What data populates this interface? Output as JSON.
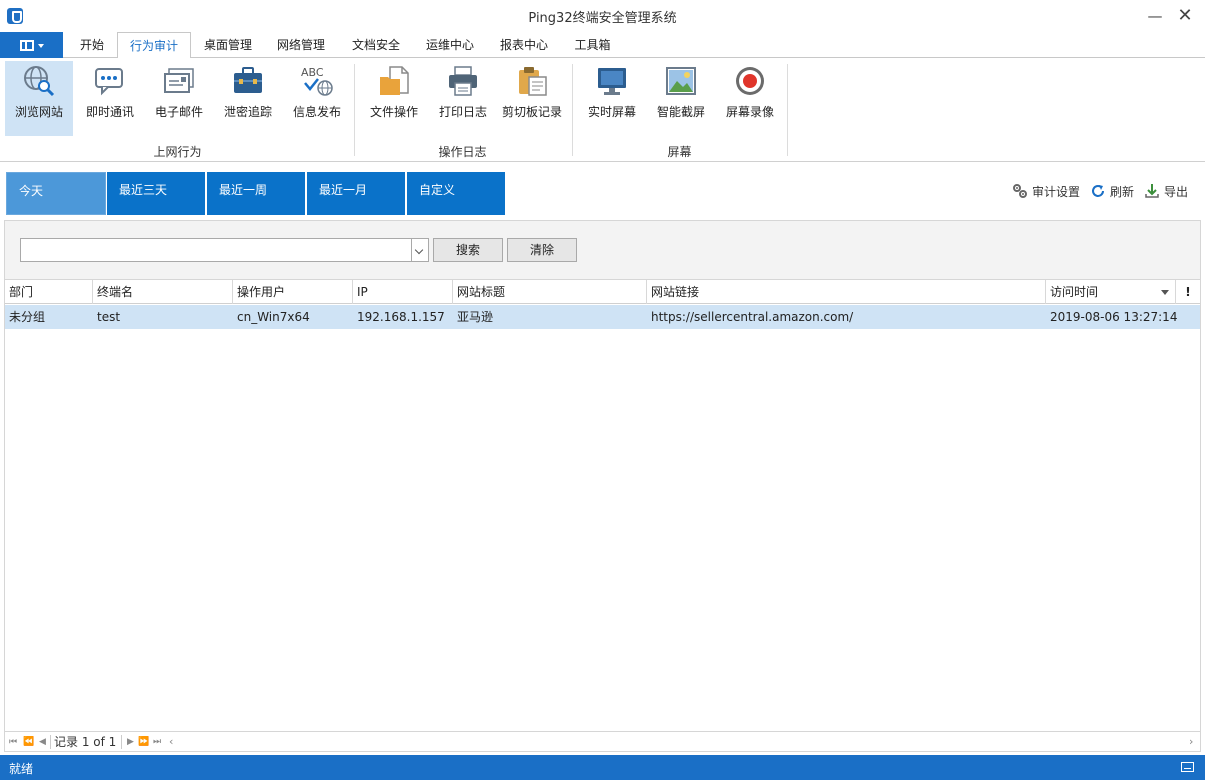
{
  "window": {
    "title": "Ping32终端安全管理系统"
  },
  "menu": {
    "tabs": [
      "开始",
      "行为审计",
      "桌面管理",
      "网络管理",
      "文档安全",
      "运维中心",
      "报表中心",
      "工具箱"
    ],
    "active_index": 1
  },
  "ribbon": {
    "groups": [
      {
        "label": "上网行为",
        "items": [
          {
            "label": "浏览网站",
            "icon": "globe-search-icon",
            "active": true
          },
          {
            "label": "即时通讯",
            "icon": "chat-bubble-icon"
          },
          {
            "label": "电子邮件",
            "icon": "email-icon"
          },
          {
            "label": "泄密追踪",
            "icon": "briefcase-icon"
          },
          {
            "label": "信息发布",
            "icon": "abc-globe-icon",
            "icon_text": "ABC"
          }
        ]
      },
      {
        "label": "操作日志",
        "items": [
          {
            "label": "文件操作",
            "icon": "file-folder-icon"
          },
          {
            "label": "打印日志",
            "icon": "printer-icon"
          },
          {
            "label": "剪切板记录",
            "icon": "clipboard-icon"
          }
        ]
      },
      {
        "label": "屏幕",
        "items": [
          {
            "label": "实时屏幕",
            "icon": "monitor-icon"
          },
          {
            "label": "智能截屏",
            "icon": "screenshot-picture-icon"
          },
          {
            "label": "屏幕录像",
            "icon": "record-icon"
          }
        ]
      }
    ]
  },
  "date_filter": {
    "tabs": [
      "今天",
      "最近三天",
      "最近一周",
      "最近一月",
      "自定义"
    ],
    "active_index": 0
  },
  "actions": {
    "audit_settings": "审计设置",
    "refresh": "刷新",
    "export": "导出"
  },
  "search": {
    "value": "",
    "search_label": "搜索",
    "clear_label": "清除"
  },
  "table": {
    "columns": [
      "部门",
      "终端名",
      "操作用户",
      "IP",
      "网站标题",
      "网站链接",
      "访问时间"
    ],
    "rows": [
      [
        "未分组",
        "test",
        "cn_Win7x64",
        "192.168.1.157",
        "亚马逊",
        "https://sellercentral.amazon.com/",
        "2019-08-06 13:27:14"
      ]
    ]
  },
  "pager": {
    "text": "记录 1 of 1"
  },
  "status": {
    "text": "就绪"
  },
  "colors": {
    "accent": "#1a6fc6",
    "selected_row": "#cfe3f5",
    "date_tab": "#0a72c9"
  }
}
